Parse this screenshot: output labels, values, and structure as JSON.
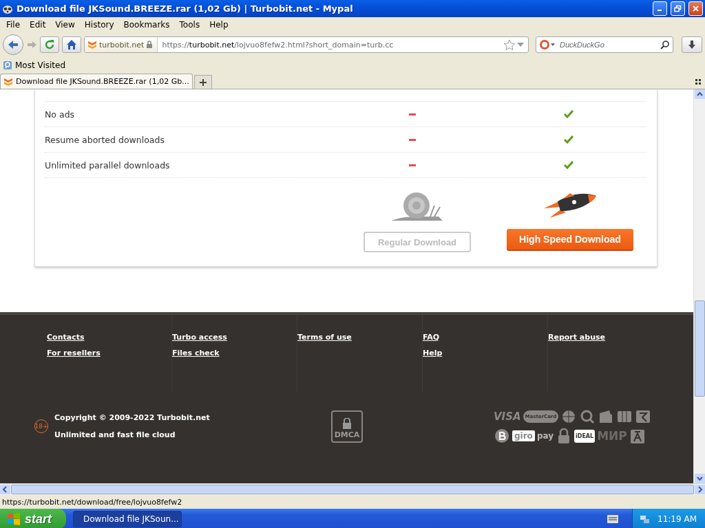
{
  "window": {
    "title": "Download file JKSound.BREEZE.rar (1,02 Gb) | Turbobit.net - Mypal"
  },
  "menu": [
    "File",
    "Edit",
    "View",
    "History",
    "Bookmarks",
    "Tools",
    "Help"
  ],
  "address_bar": {
    "site_label": "turbobit.net",
    "url_prefix": "https://",
    "url_host": "turbobit.net",
    "url_path": "/lojvuo8fefw2.html?short_domain=turb.cc"
  },
  "search": {
    "placeholder": "DuckDuckGo"
  },
  "bookmarks": [
    "Most Visited"
  ],
  "tabs": [
    {
      "label": "Download file JKSound.BREEZE.rar (1,02 Gb...",
      "selected": true
    }
  ],
  "features": [
    {
      "name": "No ads",
      "regular": false,
      "premium": true
    },
    {
      "name": "Resume aborted downloads",
      "regular": false,
      "premium": true
    },
    {
      "name": "Unlimited parallel downloads",
      "regular": false,
      "premium": true
    }
  ],
  "buttons": [
    {
      "label": "Regular Download",
      "kind": "regular"
    },
    {
      "label": "High Speed Download",
      "kind": "premium"
    }
  ],
  "footer": {
    "columns": [
      {
        "links": [
          "Contacts",
          "For resellers"
        ]
      },
      {
        "links": [
          "Turbo access",
          "Files check"
        ]
      },
      {
        "links": [
          "Terms of use"
        ]
      },
      {
        "links": [
          "FAQ",
          "Help"
        ]
      },
      {
        "links": [
          "Report abuse"
        ]
      }
    ],
    "age_badge": "18+",
    "copyright": "Copyright © 2009-2022 Turbobit.net",
    "tagline": "Unlimited and fast file cloud",
    "dmca": "DMCA",
    "payment_texts": [
      "VISA",
      "MasterCard",
      "giro",
      "pay",
      "iDEAL",
      "МИР"
    ]
  },
  "status_bar": {
    "text": "https://turbobit.net/download/free/lojvuo8fefw2"
  },
  "taskbar": {
    "start": "start",
    "tasks": [
      {
        "label": "Download file JKSoun...",
        "selected": true
      }
    ],
    "clock": "11:19 AM"
  }
}
